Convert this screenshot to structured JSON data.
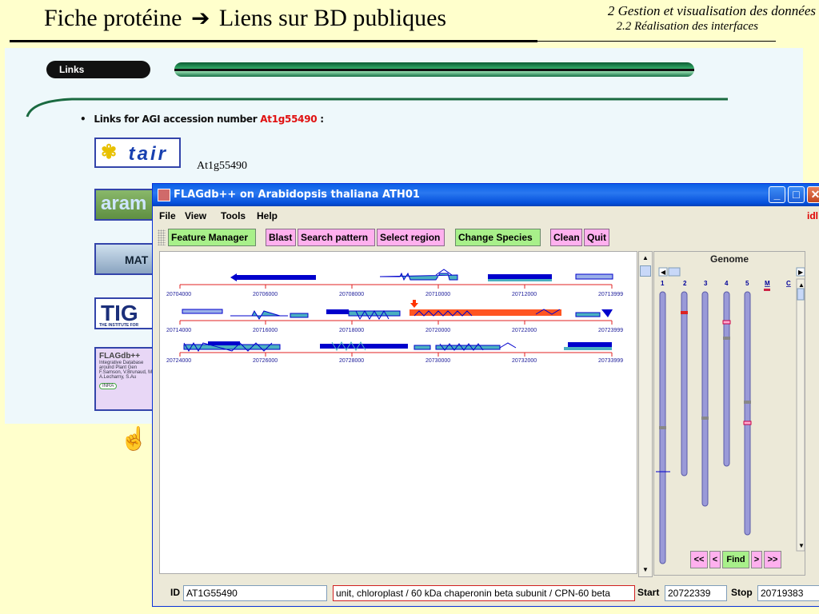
{
  "slide": {
    "title_left": "Fiche protéine",
    "title_arrow": "➔",
    "title_right": "Liens sur BD publiques",
    "section": "2 Gestion et visualisation des données",
    "subsection": "2.2 Réalisation des interfaces"
  },
  "webpage": {
    "links_header": "Links",
    "links_prefix": "Links for AGI accession number",
    "agi_number": "At1g55490",
    "links_suffix": ":",
    "tair_logo": "tair",
    "tair_accession": "At1g55490",
    "logo_ara": "aram",
    "logo_mat": "MAT",
    "logo_tigr": "TIG",
    "logo_tigr_sub": "THE INSTITUTE FOR",
    "logo_flag_title": "FLAGdb++",
    "logo_flag_line1": "Integrative Database",
    "logo_flag_line2": "around Plant Gen",
    "logo_flag_line3": "F.Samson, V.Brunaud, M.",
    "logo_flag_line4": "A.Lecharny, S.Au",
    "logo_flag_inra": "INRA",
    "hand_icon": "pointing-hand-icon"
  },
  "window": {
    "title": "FLAGdb++ on Arabidopsis thaliana ATH01",
    "status": "idl",
    "menu": [
      "File",
      "View",
      "Tools",
      "Help"
    ],
    "toolbar": [
      "Feature Manager",
      "Blast",
      "Search pattern",
      "Select region",
      "Change Species",
      "Clean",
      "Quit"
    ],
    "genome_label": "Genome",
    "chromosome_labels": [
      "1",
      "2",
      "3",
      "4",
      "5",
      "M",
      "C"
    ],
    "nav_buttons": [
      "<<",
      "<",
      "Find",
      ">",
      ">>"
    ],
    "id_label": "ID",
    "id_value": "AT1G55490",
    "description": "unit, chloroplast / 60 kDa chaperonin beta subunit / CPN-60 beta",
    "start_label": "Start",
    "start_value": "20722339",
    "stop_label": "Stop",
    "stop_value": "20719383",
    "tracks": [
      {
        "ticks": [
          "20704000",
          "20706000",
          "20708000",
          "20710000",
          "20712000",
          "20713999"
        ]
      },
      {
        "ticks": [
          "20714000",
          "20716000",
          "20718000",
          "20720000",
          "20722000",
          "20723999"
        ]
      },
      {
        "ticks": [
          "20724000",
          "20726000",
          "20728000",
          "20730000",
          "20732000",
          "20733999"
        ]
      }
    ],
    "colors": {
      "gene_blue": "#0000cc",
      "gene_cyan": "#4ab0c0",
      "highlight_red": "#ff5522",
      "axis_red": "#e02020",
      "chromosome": "#9a9ad8"
    }
  }
}
